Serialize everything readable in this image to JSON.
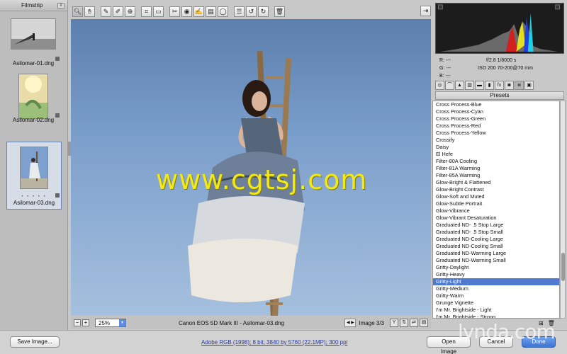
{
  "filmstrip": {
    "title": "Filmstrip",
    "items": [
      {
        "name": "Asilomar-01.dng"
      },
      {
        "name": "Asilomar-02.dng"
      },
      {
        "name": "Asilomar-03.dng",
        "selected": true,
        "stars": "• • • • •"
      }
    ]
  },
  "toolbar": {
    "tools": [
      "zoom-icon",
      "hand-icon",
      "white-balance-icon",
      "color-sampler-icon",
      "target-adjust-icon",
      "crop-icon",
      "straighten-icon",
      "spot-removal-icon",
      "red-eye-icon",
      "adjustment-brush-icon",
      "graduated-filter-icon",
      "radial-filter-icon",
      "list-icon",
      "rotate-left-icon",
      "rotate-right-icon",
      "trash-icon"
    ],
    "fullscreen": "fullscreen-icon"
  },
  "preview": {
    "watermark": "www.cgtsj.com"
  },
  "status": {
    "zoom": "25%",
    "camera_file": "Canon EOS 5D Mark III  -  Asilomar-03.dng",
    "image_count": "Image 3/3"
  },
  "info": {
    "r": "R:   ---",
    "g": "G:   ---",
    "b": "B:   ---",
    "aperture_shutter": "f/2.8    1/8000 s",
    "iso_lens": "ISO 200    70-200@70 mm"
  },
  "presets": {
    "title": "Presets",
    "items": [
      "Cross Process-Blue",
      "Cross Process-Cyan",
      "Cross Process-Green",
      "Cross Process-Red",
      "Cross Process-Yellow",
      "Crossify",
      "Daisy",
      "El Hefe",
      "Filter-80A Cooling",
      "Filter-81A Warming",
      "Filter-85A Warming",
      "Glow-Bright & Flattened",
      "Glow-Bright Contrast",
      "Glow-Soft and Muted",
      "Glow-Subtle Portrait",
      "Glow-Vibrance",
      "Glow-Vibrant Desaturation",
      "Graduated ND- .5 Stop Large",
      "Graduated ND- .5 Stop Small",
      "Graduated ND-Cooling Large",
      "Graduated ND-Cooling Small",
      "Graduated ND-Warming Large",
      "Graduated ND-Warming Small",
      "Gritty-Daylight",
      "Gritty-Heavy",
      "Gritty-Light",
      "Gritty-Medium",
      "Gritty-Warm",
      "Grunge Vignette",
      "I'm Mr. Brightside - Light",
      "I'm Mr. Brightside - Strong"
    ],
    "selected_index": 25
  },
  "bottom": {
    "save_label": "Save Image...",
    "workflow_link": "Adobe RGB (1998); 8 bit; 3840 by 5760 (22.1MP); 300 ppi",
    "open_label": "Open Image",
    "cancel_label": "Cancel",
    "done_label": "Done"
  },
  "brand": "lynda.com"
}
